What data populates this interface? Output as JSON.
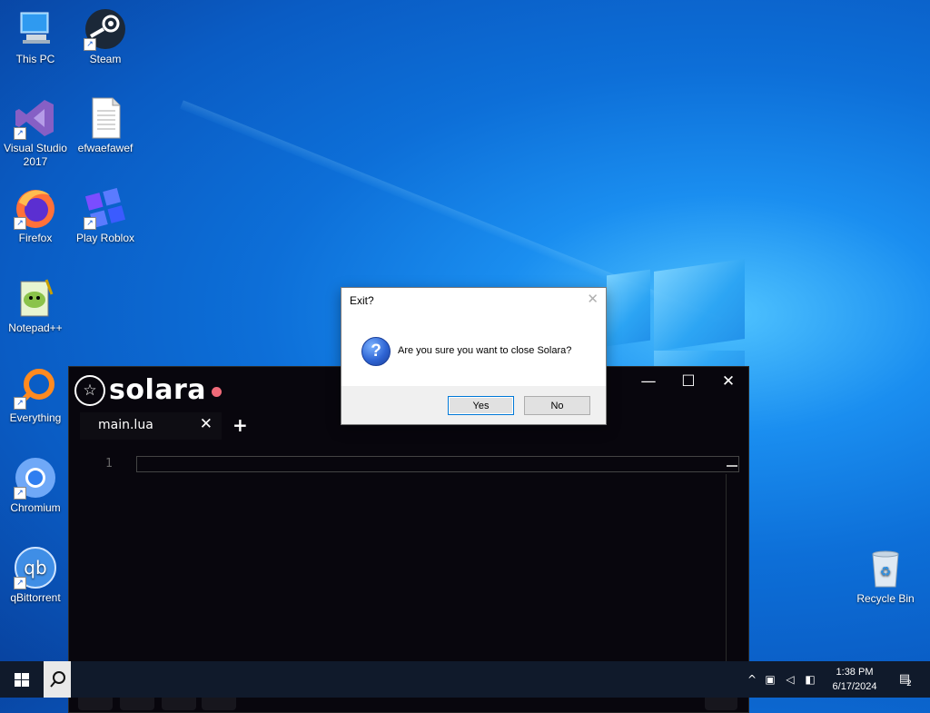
{
  "desktop": {
    "icons": [
      {
        "label": "This PC",
        "icon": "computer-icon"
      },
      {
        "label": "Steam",
        "icon": "steam-icon"
      },
      {
        "label": "Visual Studio 2017",
        "icon": "visual-studio-icon"
      },
      {
        "label": "efwaefawef",
        "icon": "text-file-icon"
      },
      {
        "label": "Firefox",
        "icon": "firefox-icon"
      },
      {
        "label": "Play Roblox",
        "icon": "roblox-icon"
      },
      {
        "label": "Notepad++",
        "icon": "notepad-plus-plus-icon"
      },
      {
        "label": "Everything",
        "icon": "everything-search-icon"
      },
      {
        "label": "Chromium",
        "icon": "chromium-icon"
      },
      {
        "label": "qBittorrent",
        "icon": "qbittorrent-icon"
      },
      {
        "label": "Recycle Bin",
        "icon": "recycle-bin-icon"
      }
    ]
  },
  "solara": {
    "app_name": "solara",
    "brand_dot_color": "#f06a79",
    "tab_label": "main.lua",
    "tab_close": "✕",
    "tab_add": "+",
    "line_number": "1",
    "controls": {
      "minimize": "—",
      "maximize": "☐",
      "close": "✕"
    }
  },
  "dialog": {
    "title": "Exit?",
    "close": "✕",
    "message": "Are you sure you want to close Solara?",
    "yes_label": "Yes",
    "no_label": "No"
  },
  "taskbar": {
    "time": "1:38 PM",
    "date": "6/17/2024",
    "notification_count": "2"
  }
}
